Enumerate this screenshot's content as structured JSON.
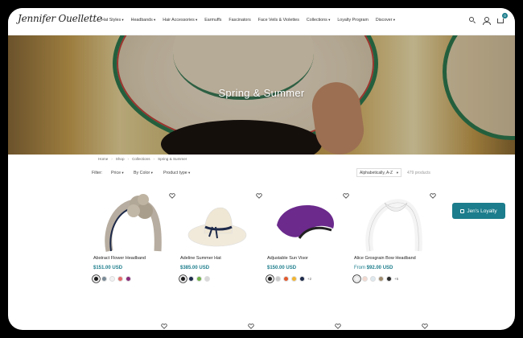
{
  "header": {
    "logo_text": "Jennifer Ouellette",
    "nav": [
      {
        "label": "Hat Styles",
        "caret": true
      },
      {
        "label": "Headbands",
        "caret": true
      },
      {
        "label": "Hair Accessories",
        "caret": true
      },
      {
        "label": "Earmuffs",
        "caret": false
      },
      {
        "label": "Fascinators",
        "caret": false
      },
      {
        "label": "Face Veils & Violettes",
        "caret": false
      },
      {
        "label": "Collections",
        "caret": true
      },
      {
        "label": "Loyalty Program",
        "caret": false
      },
      {
        "label": "Discover",
        "caret": true
      }
    ],
    "cart_count": "0",
    "icons": [
      "search-icon",
      "user-icon",
      "cart-icon"
    ]
  },
  "hero": {
    "title": "Spring & Summer"
  },
  "breadcrumb": [
    "Home",
    "Shop",
    "Collections",
    "Spring & Summer"
  ],
  "filters": {
    "label": "Filter:",
    "options": [
      "Price",
      "By Color",
      "Product type"
    ],
    "sort_value": "Alphabetically, A-Z",
    "count": "479 products"
  },
  "products": [
    {
      "name": "Abstract Flower Headband",
      "price": "$151.00 USD",
      "price_prefix": "",
      "swatches": [
        "#1b1b1b",
        "#7a8a96",
        "#f2f2f2",
        "#e46a6a",
        "#8a2a7a"
      ],
      "more": ""
    },
    {
      "name": "Adeline Summer Hat",
      "price": "$385.00 USD",
      "price_prefix": "",
      "swatches": [
        "#1b1b1b",
        "#1e2a4a",
        "#6fb14a",
        "#d8d8d8"
      ],
      "more": ""
    },
    {
      "name": "Adjustable Sun Visor",
      "price": "$150.00 USD",
      "price_prefix": "",
      "swatches": [
        "#1b1b1b",
        "#c9c9c9",
        "#e2592b",
        "#f2b530",
        "#1e2a4a"
      ],
      "more": "+2"
    },
    {
      "name": "Alice Grosgrain Bow Headband",
      "price": "$92.00 USD",
      "price_prefix": "From ",
      "swatches": [
        "#f4f4f4",
        "#f3d9cf",
        "#dde9ef",
        "#a08c6f",
        "#2a2a2a"
      ],
      "more": "+5"
    }
  ],
  "loyalty_button": "Jen's Loyalty",
  "colors": {
    "accent": "#1c7d8c"
  }
}
